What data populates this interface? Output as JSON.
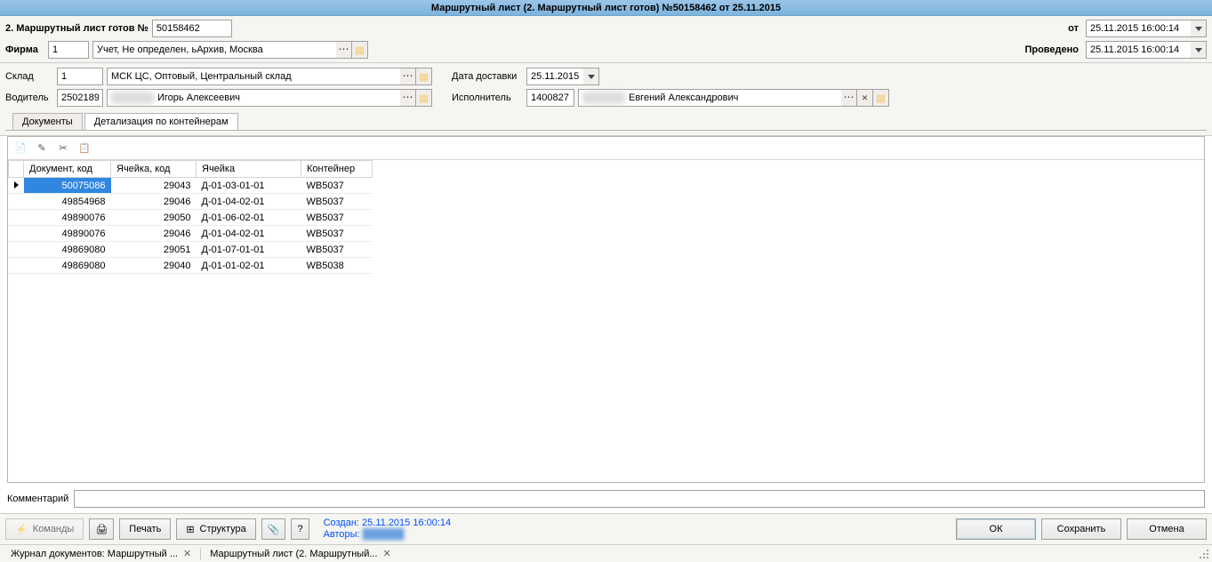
{
  "window_title": "Маршрутный лист (2. Маршрутный лист готов) №50158462 от 25.11.2015",
  "header": {
    "doc_status_label": "2. Маршрутный лист готов №",
    "doc_number": "50158462",
    "ot_label": "от",
    "ot_value": "25.11.2015 16:00:14",
    "firma_label": "Фирма",
    "firma_code": "1",
    "firma_name": "Учет, Не определен, ьАрхив, Москва",
    "provedeno_label": "Проведено",
    "provedeno_value": "25.11.2015 16:00:14"
  },
  "fields": {
    "sklad_label": "Склад",
    "sklad_code": "1",
    "sklad_name": "МСК ЦС, Оптовый, Центральный склад",
    "data_dostavki_label": "Дата доставки",
    "data_dostavki_value": "25.11.2015",
    "voditel_label": "Водитель",
    "voditel_code": "2502189",
    "voditel_name": "Игорь Алексеевич",
    "ispolnitel_label": "Исполнитель",
    "ispolnitel_code": "1400827",
    "ispolnitel_name": "Евгений Александрович"
  },
  "tabs": {
    "documents": "Документы",
    "details": "Детализация по контейнерам"
  },
  "grid": {
    "columns": {
      "doc_code": "Документ, код",
      "cell_code": "Ячейка, код",
      "cell": "Ячейка",
      "container": "Контейнер"
    },
    "rows": [
      {
        "doc_code": "50075086",
        "cell_code": "29043",
        "cell": "Д-01-03-01-01",
        "container": "WB5037"
      },
      {
        "doc_code": "49854968",
        "cell_code": "29046",
        "cell": "Д-01-04-02-01",
        "container": "WB5037"
      },
      {
        "doc_code": "49890076",
        "cell_code": "29050",
        "cell": "Д-01-06-02-01",
        "container": "WB5037"
      },
      {
        "doc_code": "49890076",
        "cell_code": "29046",
        "cell": "Д-01-04-02-01",
        "container": "WB5037"
      },
      {
        "doc_code": "49869080",
        "cell_code": "29051",
        "cell": "Д-01-07-01-01",
        "container": "WB5037"
      },
      {
        "doc_code": "49869080",
        "cell_code": "29040",
        "cell": "Д-01-01-02-01",
        "container": "WB5038"
      }
    ]
  },
  "comment_label": "Комментарий",
  "footer": {
    "commands": "Команды",
    "print": "Печать",
    "structure": "Структура",
    "created_label": "Создан:",
    "created_value": "25.11.2015 16:00:14",
    "authors_label": "Авторы:",
    "ok": "ОК",
    "save": "Сохранить",
    "cancel": "Отмена"
  },
  "statusbar": {
    "tab1": "Журнал документов: Маршрутный ...",
    "tab2": "Маршрутный лист (2. Маршрутный..."
  }
}
